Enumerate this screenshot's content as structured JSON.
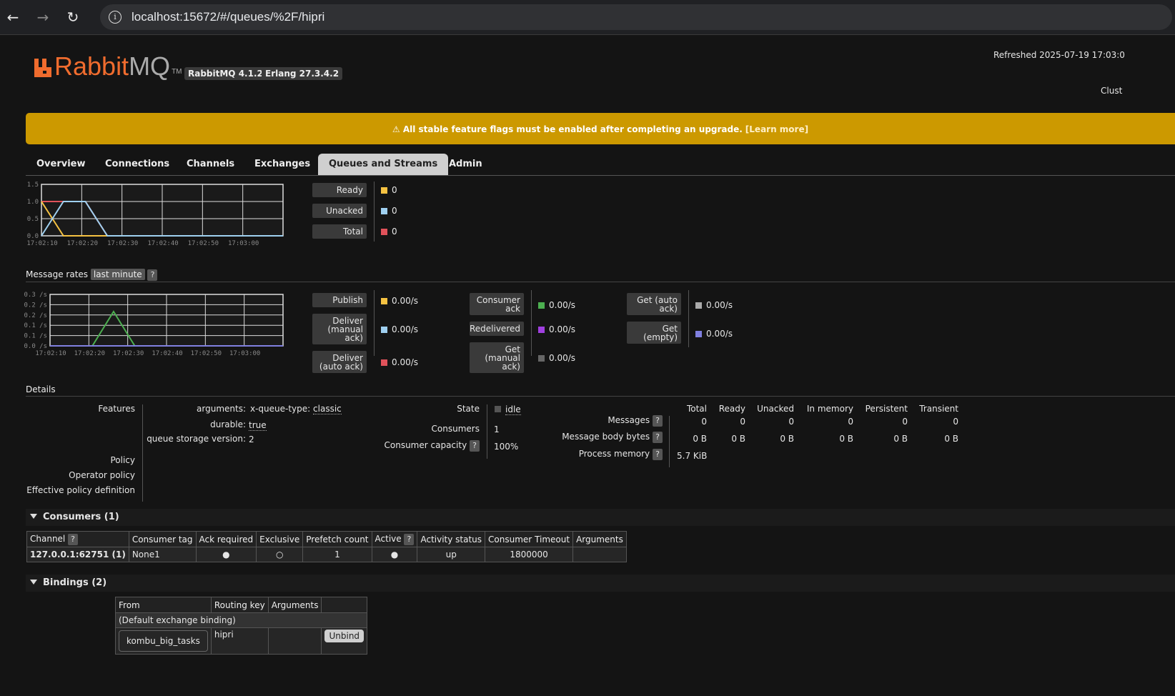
{
  "browser": {
    "url": "localhost:15672/#/queues/%2F/hipri",
    "back_icon": "←",
    "forward_icon": "→",
    "reload_icon": "↻",
    "info_icon": "i"
  },
  "header": {
    "logo_rabbit": "Rabbit",
    "logo_mq": "MQ",
    "logo_tm": "TM",
    "rabbitmq_version": "RabbitMQ 4.1.2",
    "erlang_version": "Erlang 27.3.4.2",
    "refreshed": "Refreshed 2025-07-19 17:03:0",
    "cluster": "Clust"
  },
  "banner": {
    "text": "⚠ All stable feature flags must be enabled after completing an upgrade.",
    "link": "[Learn more]"
  },
  "tabs": [
    "Overview",
    "Connections",
    "Channels",
    "Exchanges",
    "Queues and Streams",
    "Admin"
  ],
  "active_tab": "Queues and Streams",
  "colors": {
    "ready": "#f5c242",
    "unacked": "#9fd0f0",
    "total": "#e0525a",
    "consumer_ack": "#4caf50",
    "redelivered": "#a040e0",
    "get_manual": "#666666",
    "get_auto": "#aaaaaa",
    "get_empty": "#8080e0",
    "deliver_line": "#4caf50"
  },
  "queued_chart": {
    "y_ticks": [
      "1.5",
      "1.0",
      "0.5",
      "0.0"
    ],
    "x_ticks": [
      "17:02:10",
      "17:02:20",
      "17:02:30",
      "17:02:40",
      "17:02:50",
      "17:03:00"
    ],
    "ylim": [
      0,
      1.5
    ],
    "xlim": [
      0,
      55
    ],
    "series": [
      {
        "key": "total",
        "points": [
          [
            0,
            1
          ],
          [
            10,
            1
          ],
          [
            15,
            0
          ],
          [
            55,
            0
          ]
        ]
      },
      {
        "key": "ready",
        "points": [
          [
            0,
            1
          ],
          [
            5,
            0
          ],
          [
            55,
            0
          ]
        ]
      },
      {
        "key": "unacked",
        "points": [
          [
            0,
            0
          ],
          [
            5,
            1
          ],
          [
            10,
            1
          ],
          [
            15,
            0
          ],
          [
            55,
            0
          ]
        ]
      }
    ],
    "legend": [
      {
        "label": "Ready",
        "value": "0",
        "color_key": "ready"
      },
      {
        "label": "Unacked",
        "value": "0",
        "color_key": "unacked"
      },
      {
        "label": "Total",
        "value": "0",
        "color_key": "total"
      }
    ]
  },
  "rates_section": {
    "title": "Message rates",
    "period": "last minute",
    "help": "?"
  },
  "rates_chart": {
    "y_ticks": [
      "0.3 /s",
      "0.2 /s",
      "0.2 /s",
      "0.1 /s",
      "0.1 /s",
      "0.0 /s"
    ],
    "x_ticks": [
      "17:02:10",
      "17:02:20",
      "17:02:30",
      "17:02:40",
      "17:02:50",
      "17:03:00"
    ],
    "ylim": [
      0,
      0.3
    ],
    "xlim": [
      0,
      55
    ],
    "series": [
      {
        "key": "deliver_line",
        "points": [
          [
            0,
            0
          ],
          [
            10,
            0
          ],
          [
            15,
            0.2
          ],
          [
            20,
            0
          ],
          [
            55,
            0
          ]
        ]
      },
      {
        "key": "get_empty",
        "points": [
          [
            0,
            0
          ],
          [
            55,
            0
          ]
        ]
      }
    ],
    "col1": [
      {
        "label": "Publish",
        "value": "0.00/s",
        "color_key": "ready"
      },
      {
        "label": "Deliver (manual ack)",
        "value": "0.00/s",
        "color_key": "unacked"
      },
      {
        "label": "Deliver (auto ack)",
        "value": "0.00/s",
        "color_key": "total"
      }
    ],
    "col2": [
      {
        "label": "Consumer ack",
        "value": "0.00/s",
        "color_key": "consumer_ack"
      },
      {
        "label": "Redelivered",
        "value": "0.00/s",
        "color_key": "redelivered"
      },
      {
        "label": "Get (manual ack)",
        "value": "0.00/s",
        "color_key": "get_manual"
      }
    ],
    "col3": [
      {
        "label": "Get (auto ack)",
        "value": "0.00/s",
        "color_key": "get_auto"
      },
      {
        "label": "Get (empty)",
        "value": "0.00/s",
        "color_key": "get_empty"
      }
    ]
  },
  "details": {
    "title": "Details",
    "features_label": "Features",
    "policy_label": "Policy",
    "operator_policy_label": "Operator policy",
    "effective_policy_label": "Effective policy definition",
    "arguments_key": "arguments:",
    "arguments_val_key": "x-queue-type:",
    "arguments_val": "classic",
    "durable_key": "durable:",
    "durable_val": "true",
    "storage_key": "queue storage version:",
    "storage_val": "2",
    "state_key": "State",
    "state_val": "idle",
    "consumers_key": "Consumers",
    "consumers_val": "1",
    "capacity_key": "Consumer capacity",
    "capacity_val": "100%",
    "stats_headers": [
      "Total",
      "Ready",
      "Unacked",
      "In memory",
      "Persistent",
      "Transient"
    ],
    "messages_label": "Messages",
    "messages_vals": [
      "0",
      "0",
      "0",
      "0",
      "0",
      "0"
    ],
    "bytes_label": "Message body bytes",
    "bytes_vals": [
      "0 B",
      "0 B",
      "0 B",
      "0 B",
      "0 B",
      "0 B"
    ],
    "memory_label": "Process memory",
    "memory_val": "5.7 KiB",
    "help": "?"
  },
  "consumers": {
    "title": "Consumers (1)",
    "headers": [
      "Channel",
      "Consumer tag",
      "Ack required",
      "Exclusive",
      "Prefetch count",
      "Active",
      "Activity status",
      "Consumer Timeout",
      "Arguments"
    ],
    "row": {
      "channel": "127.0.0.1:62751 (1)",
      "tag": "None1",
      "ack": "●",
      "exclusive": "○",
      "prefetch": "1",
      "active": "●",
      "status": "up",
      "timeout": "1800000",
      "args": ""
    }
  },
  "bindings": {
    "title": "Bindings (2)",
    "headers": [
      "From",
      "Routing key",
      "Arguments"
    ],
    "default_row": "(Default exchange binding)",
    "row": {
      "from": "kombu_big_tasks",
      "key": "hipri",
      "args": "",
      "unbind": "Unbind"
    }
  }
}
